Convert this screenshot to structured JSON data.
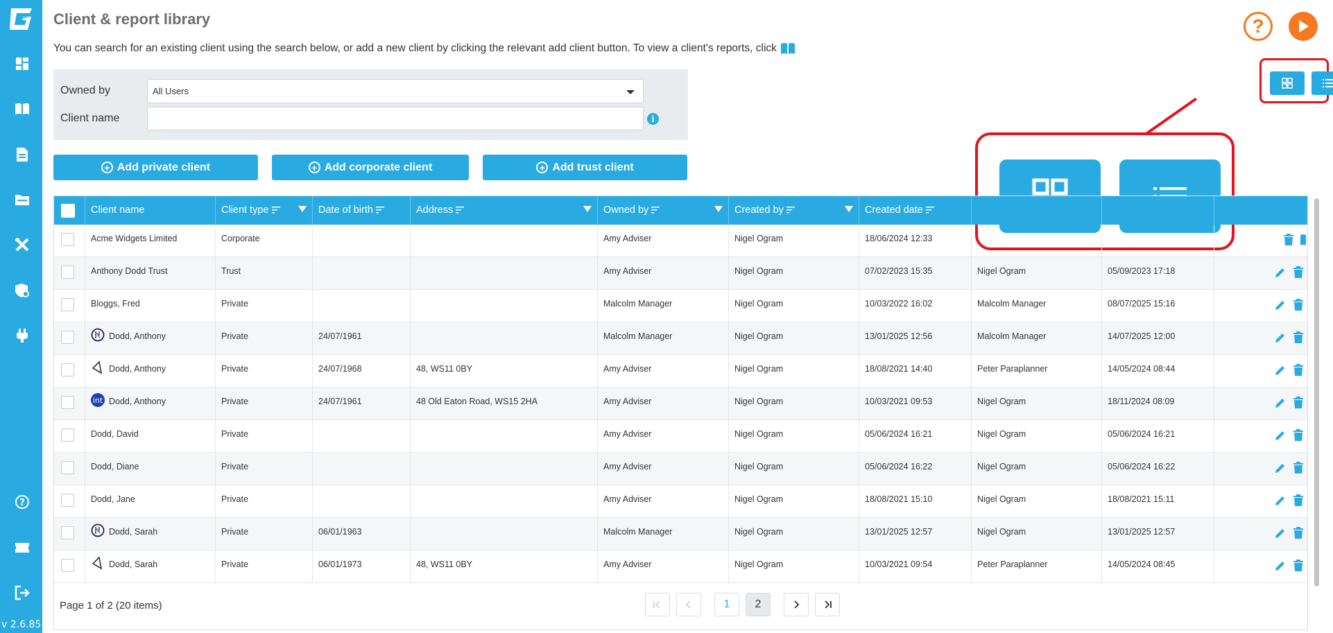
{
  "app": {
    "title": "Client & report library",
    "intro": "You can search for an existing client using the search below, or add a new client by clicking the relevant add client button. To view a client's reports, click",
    "version": "v 2.6.85"
  },
  "filters": {
    "owned_by_label": "Owned by",
    "owned_by_value": "All Users",
    "client_name_label": "Client name",
    "client_name_value": ""
  },
  "buttons": {
    "add_private": "Add private client",
    "add_corporate": "Add corporate client",
    "add_trust": "Add trust client"
  },
  "table": {
    "headers": [
      "Client name",
      "Client type",
      "Date of birth",
      "Address",
      "Owned by",
      "Created by",
      "Created date"
    ],
    "rows": [
      {
        "name": "Acme Widgets Limited",
        "type": "Corporate",
        "dob": "",
        "address": "",
        "owned_by": "Amy Adviser",
        "created_by": "Nigel Ogram",
        "created_date": "18/06/2024 12:33",
        "modified_by": "",
        "modified_date": "",
        "icon": ""
      },
      {
        "name": "Anthony Dodd Trust",
        "type": "Trust",
        "dob": "",
        "address": "",
        "owned_by": "Amy Adviser",
        "created_by": "Nigel Ogram",
        "created_date": "07/02/2023 15:35",
        "modified_by": "Nigel Ogram",
        "modified_date": "05/09/2023 17:18",
        "icon": ""
      },
      {
        "name": "Bloggs, Fred",
        "type": "Private",
        "dob": "",
        "address": "",
        "owned_by": "Malcolm Manager",
        "created_by": "Nigel Ogram",
        "created_date": "10/03/2022 16:02",
        "modified_by": "Malcolm Manager",
        "modified_date": "08/07/2025 15:16",
        "icon": ""
      },
      {
        "name": "Dodd, Anthony",
        "type": "Private",
        "dob": "24/07/1961",
        "address": "",
        "owned_by": "Malcolm Manager",
        "created_by": "Nigel Ogram",
        "created_date": "13/01/2025 12:56",
        "modified_by": "Malcolm Manager",
        "modified_date": "14/07/2025 12:00",
        "icon": "circle-logo"
      },
      {
        "name": "Dodd, Anthony",
        "type": "Private",
        "dob": "24/07/1968",
        "address": "48, WS11 0BY",
        "owned_by": "Amy Adviser",
        "created_by": "Nigel Ogram",
        "created_date": "18/08/2021 14:40",
        "modified_by": "Peter Paraplanner",
        "modified_date": "14/05/2024 08:44",
        "icon": "angle-logo"
      },
      {
        "name": "Dodd, Anthony",
        "type": "Private",
        "dob": "24/07/1961",
        "address": "48 Old Eaton Road, WS15 2HA",
        "owned_by": "Amy Adviser",
        "created_by": "Nigel Ogram",
        "created_date": "10/03/2021 09:53",
        "modified_by": "Nigel Ogram",
        "modified_date": "18/11/2024 08:09",
        "icon": "int-logo"
      },
      {
        "name": "Dodd, David",
        "type": "Private",
        "dob": "",
        "address": "",
        "owned_by": "Amy Adviser",
        "created_by": "Nigel Ogram",
        "created_date": "05/06/2024 16:21",
        "modified_by": "Nigel Ogram",
        "modified_date": "05/06/2024 16:21",
        "icon": ""
      },
      {
        "name": "Dodd, Diane",
        "type": "Private",
        "dob": "",
        "address": "",
        "owned_by": "Amy Adviser",
        "created_by": "Nigel Ogram",
        "created_date": "05/06/2024 16:22",
        "modified_by": "Nigel Ogram",
        "modified_date": "05/06/2024 16:22",
        "icon": ""
      },
      {
        "name": "Dodd, Jane",
        "type": "Private",
        "dob": "",
        "address": "",
        "owned_by": "Amy Adviser",
        "created_by": "Nigel Ogram",
        "created_date": "18/08/2021 15:10",
        "modified_by": "Nigel Ogram",
        "modified_date": "18/08/2021 15:11",
        "icon": ""
      },
      {
        "name": "Dodd, Sarah",
        "type": "Private",
        "dob": "06/01/1963",
        "address": "",
        "owned_by": "Malcolm Manager",
        "created_by": "Nigel Ogram",
        "created_date": "13/01/2025 12:57",
        "modified_by": "Nigel Ogram",
        "modified_date": "13/01/2025 12:57",
        "icon": "circle-logo"
      },
      {
        "name": "Dodd, Sarah",
        "type": "Private",
        "dob": "06/01/1973",
        "address": "48, WS11 0BY",
        "owned_by": "Amy Adviser",
        "created_by": "Nigel Ogram",
        "created_date": "10/03/2021 09:54",
        "modified_by": "Peter Paraplanner",
        "modified_date": "14/05/2024 08:45",
        "icon": "angle-logo"
      }
    ]
  },
  "pager": {
    "summary": "Page 1 of 2 (20 items)",
    "pages": [
      "1",
      "2"
    ]
  },
  "colors": {
    "brand": "#29abe2",
    "accent": "#f47920",
    "highlight": "#e3141f"
  }
}
